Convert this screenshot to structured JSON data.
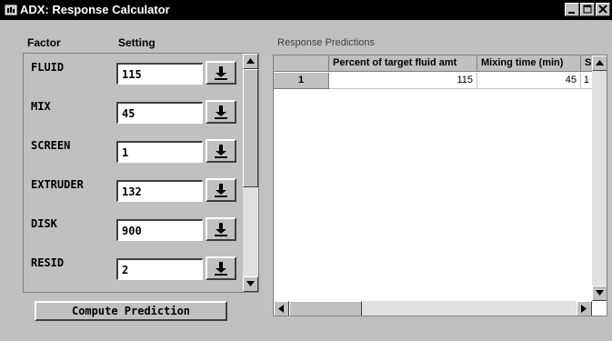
{
  "window": {
    "title": "ADX: Response Calculator"
  },
  "factors_panel": {
    "header_factor": "Factor",
    "header_setting": "Setting"
  },
  "factors": [
    {
      "name": "FLUID",
      "value": "115"
    },
    {
      "name": "MIX",
      "value": "45"
    },
    {
      "name": "SCREEN",
      "value": "1"
    },
    {
      "name": "EXTRUDER",
      "value": "132"
    },
    {
      "name": "DISK",
      "value": "900"
    },
    {
      "name": "RESID",
      "value": "2"
    }
  ],
  "compute_button": {
    "label": "Compute Prediction"
  },
  "predictions": {
    "title": "Response Predictions",
    "columns": [
      "Percent of target fluid amt",
      "Mixing time (min)",
      "S"
    ],
    "rows": [
      {
        "row_label": "1",
        "cells": [
          "115",
          "45",
          "1"
        ]
      }
    ]
  },
  "colors": {
    "titlebar": "#000000",
    "window_bg": "#c0c0c0",
    "grid_bg": "#ffffff"
  }
}
